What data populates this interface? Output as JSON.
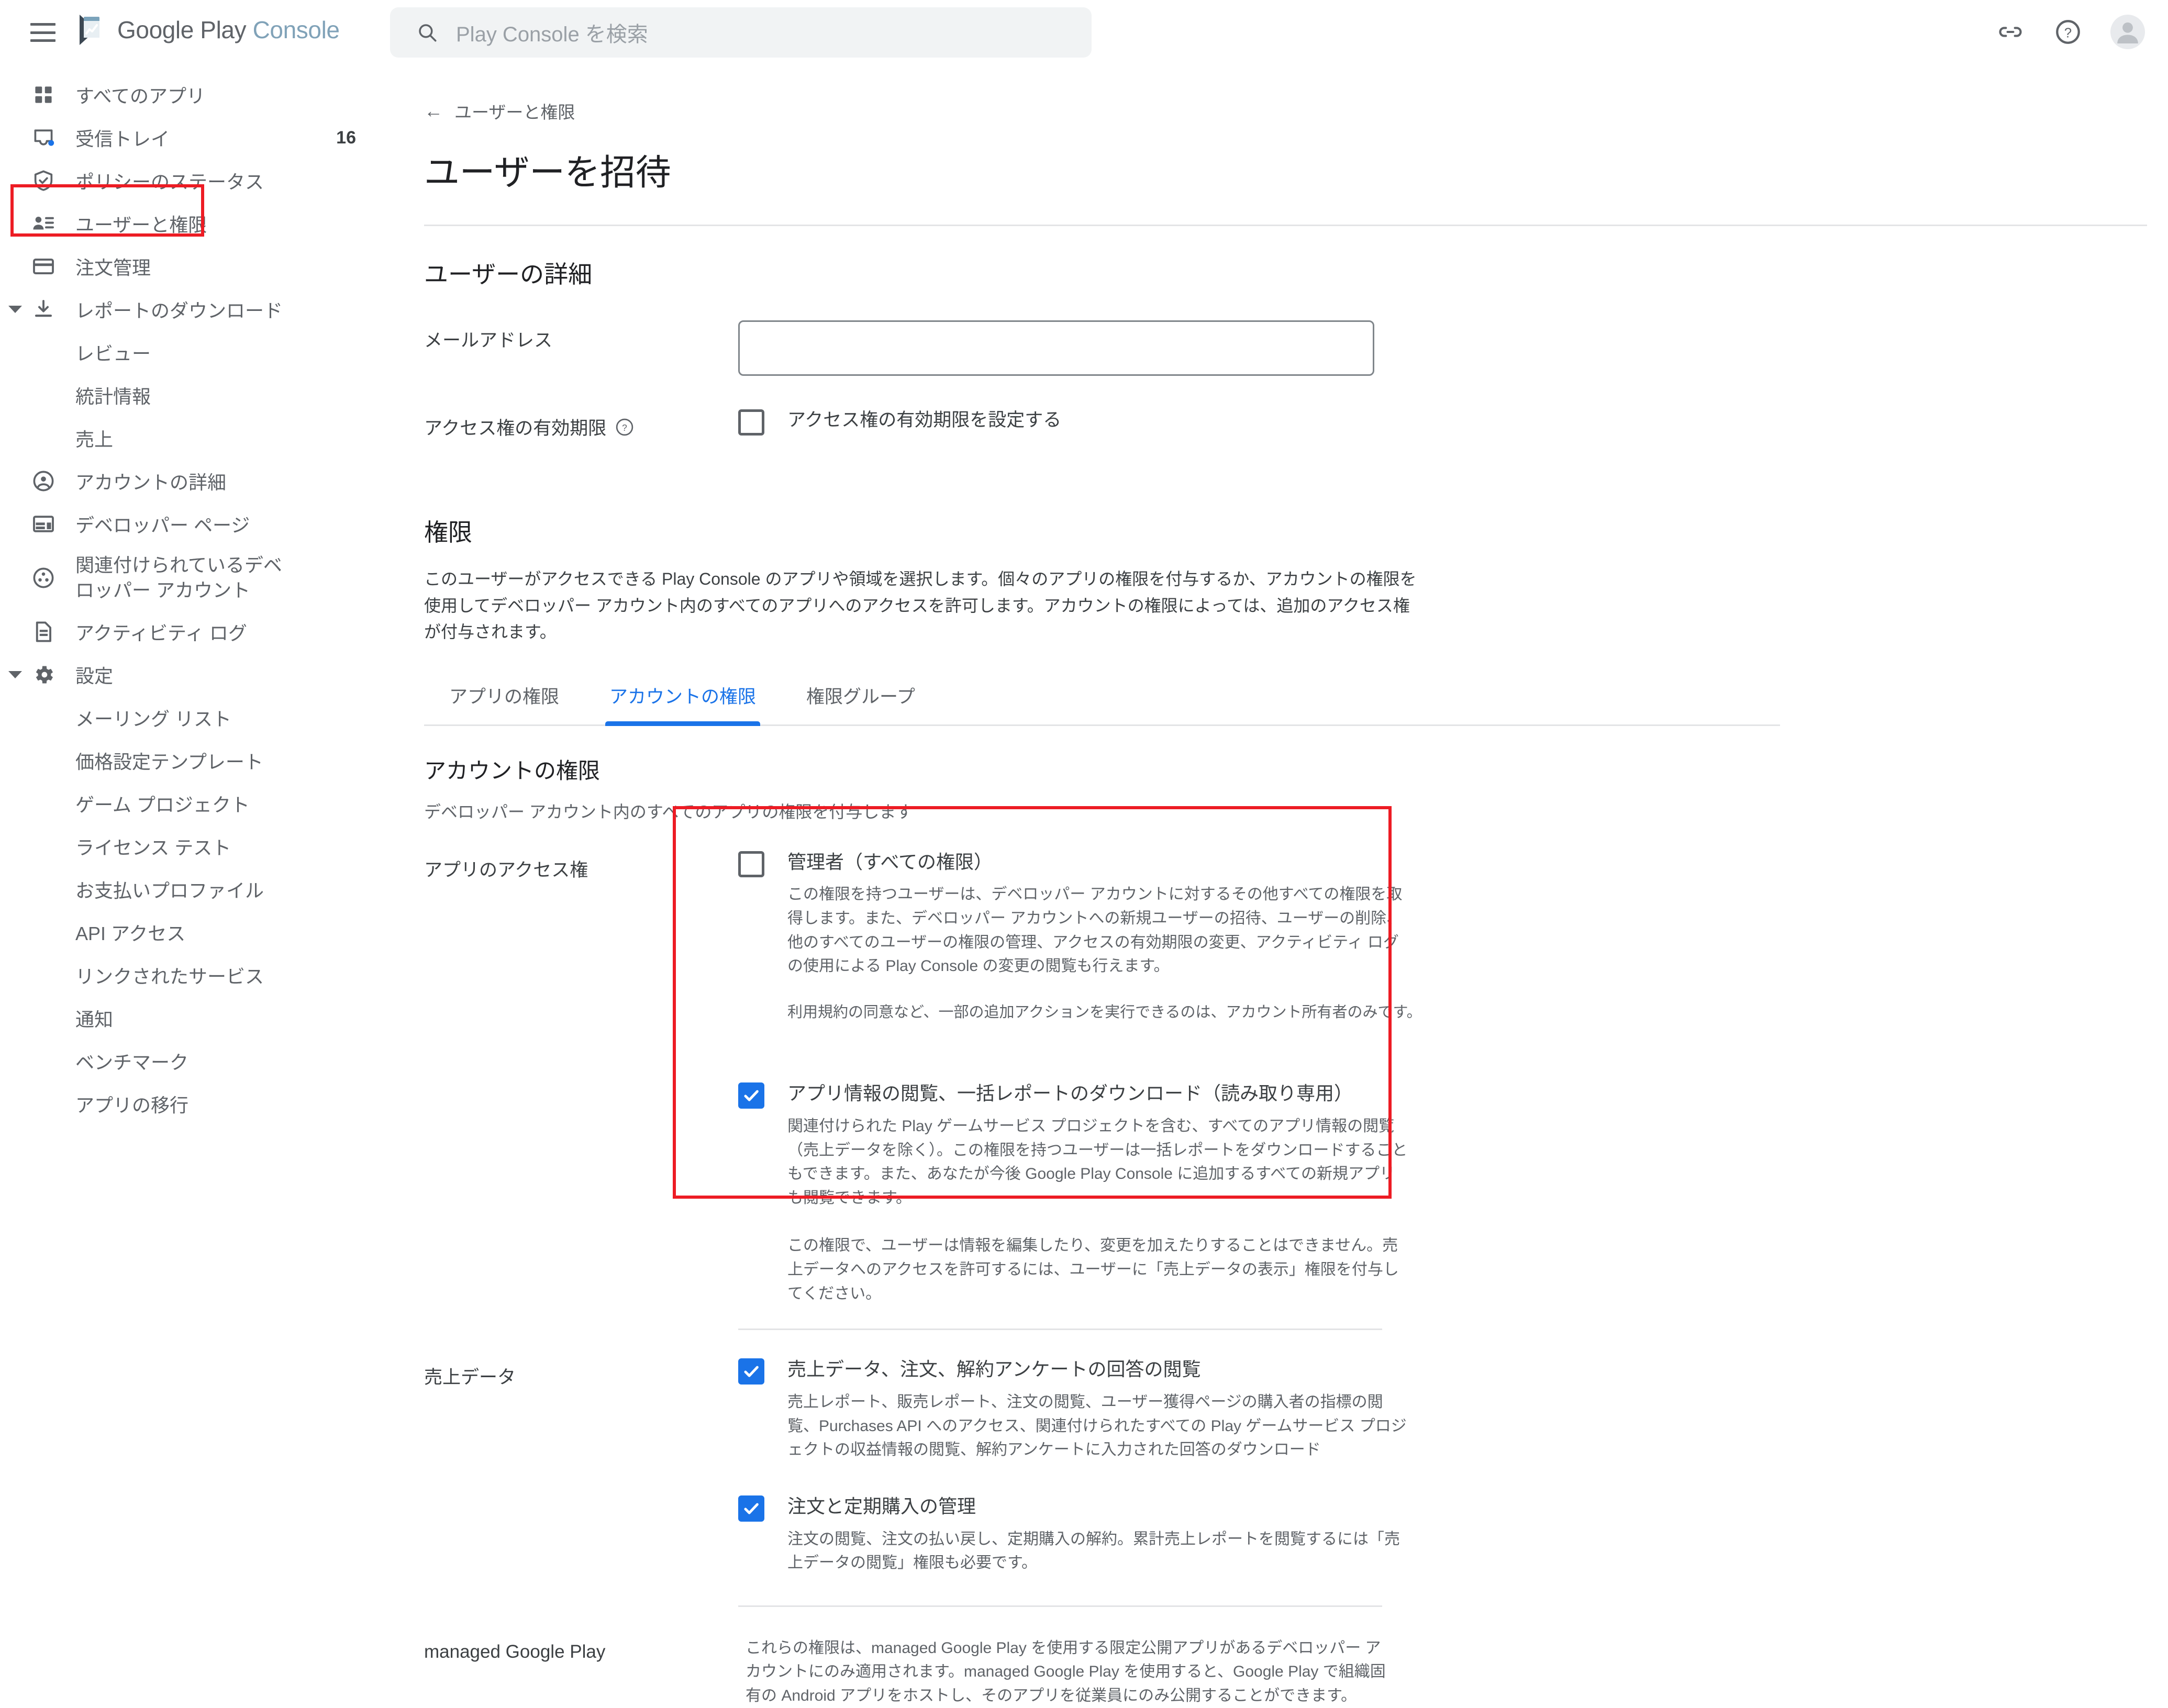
{
  "header": {
    "menu_icon": "hamburger-menu-icon",
    "brand_google": "Google Play",
    "brand_console": "Console",
    "search_placeholder": "Play Console を検索",
    "search_icon": "search-icon",
    "link_icon": "link-icon",
    "help_icon": "help-circle-icon",
    "avatar_icon": "account-avatar-icon"
  },
  "sidebar": {
    "items": [
      {
        "label": "すべてのアプリ",
        "icon": "apps-grid-icon",
        "badge": ""
      },
      {
        "label": "受信トレイ",
        "icon": "inbox-icon",
        "badge": "16"
      },
      {
        "label": "ポリシーのステータス",
        "icon": "shield-check-icon",
        "badge": ""
      },
      {
        "label": "ユーザーと権限",
        "icon": "users-permissions-icon",
        "badge": ""
      },
      {
        "label": "注文管理",
        "icon": "credit-card-icon",
        "badge": ""
      },
      {
        "label": "レポートのダウンロード",
        "icon": "download-icon",
        "badge": ""
      }
    ],
    "reports_children": [
      {
        "label": "レビュー"
      },
      {
        "label": "統計情報"
      },
      {
        "label": "売上"
      }
    ],
    "items2": [
      {
        "label": "アカウントの詳細",
        "icon": "account-circle-icon"
      },
      {
        "label": "デベロッパー ページ",
        "icon": "developer-page-icon"
      },
      {
        "label": "関連付けられているデベロッパー アカウント",
        "icon": "linked-accounts-icon"
      },
      {
        "label": "アクティビティ ログ",
        "icon": "activity-log-icon"
      },
      {
        "label": "設定",
        "icon": "gear-icon"
      }
    ],
    "settings_children": [
      {
        "label": "メーリング リスト"
      },
      {
        "label": "価格設定テンプレート"
      },
      {
        "label": "ゲーム プロジェクト"
      },
      {
        "label": "ライセンス テスト"
      },
      {
        "label": "お支払いプロファイル"
      },
      {
        "label": "API アクセス"
      },
      {
        "label": "リンクされたサービス"
      },
      {
        "label": "通知"
      },
      {
        "label": "ベンチマーク"
      },
      {
        "label": "アプリの移行"
      }
    ]
  },
  "main": {
    "breadcrumb": "ユーザーと権限",
    "breadcrumb_arrow": "←",
    "page_title": "ユーザーを招待",
    "user_details": {
      "heading": "ユーザーの詳細",
      "email_label": "メールアドレス",
      "email_value": "",
      "email_placeholder": "",
      "expiry_label": "アクセス権の有効期限",
      "expiry_help_icon": "help-circle-icon",
      "expiry_checkbox_label": "アクセス権の有効期限を設定する",
      "expiry_checked": false
    },
    "permissions": {
      "heading": "権限",
      "description": "このユーザーがアクセスできる Play Console のアプリや領域を選択します。個々のアプリの権限を付与するか、アカウントの権限を使用してデベロッパー アカウント内のすべてのアプリへのアクセスを許可します。アカウントの権限によっては、追加のアクセス権が付与されます。",
      "tabs": [
        {
          "label": "アプリの権限",
          "active": false
        },
        {
          "label": "アカウントの権限",
          "active": true
        },
        {
          "label": "権限グループ",
          "active": false
        }
      ],
      "account_heading": "アカウントの権限",
      "account_subnote": "デベロッパー アカウント内のすべてのアプリの権限を付与します",
      "groups": [
        {
          "label": "アプリのアクセス権",
          "options": [
            {
              "title": "管理者（すべての権限）",
              "checked": false,
              "desc": "この権限を持つユーザーは、デベロッパー アカウントに対するその他すべての権限を取得します。また、デベロッパー アカウントへの新規ユーザーの招待、ユーザーの削除、他のすべてのユーザーの権限の管理、アクセスの有効期限の変更、アクティビティ ログの使用による Play Console の変更の閲覧も行えます。",
              "note": "利用規約の同意など、一部の追加アクションを実行できるのは、アカウント所有者のみです。"
            },
            {
              "title": "アプリ情報の閲覧、一括レポートのダウンロード（読み取り専用）",
              "checked": true,
              "desc": "関連付けられた Play ゲームサービス プロジェクトを含む、すべてのアプリ情報の閲覧（売上データを除く）。この権限を持つユーザーは一括レポートをダウンロードすることもできます。また、あなたが今後 Google Play Console に追加するすべての新規アプリも閲覧できます。",
              "desc2": "この権限で、ユーザーは情報を編集したり、変更を加えたりすることはできません。売上データへのアクセスを許可するには、ユーザーに「売上データの表示」権限を付与してください。"
            }
          ]
        },
        {
          "label": "売上データ",
          "options": [
            {
              "title": "売上データ、注文、解約アンケートの回答の閲覧",
              "checked": true,
              "desc": "売上レポート、販売レポート、注文の閲覧、ユーザー獲得ページの購入者の指標の閲覧、Purchases API へのアクセス、関連付けられたすべての Play ゲームサービス プロジェクトの収益情報の閲覧、解約アンケートに入力された回答のダウンロード"
            },
            {
              "title": "注文と定期購入の管理",
              "checked": true,
              "desc": "注文の閲覧、注文の払い戻し、定期購入の解約。累計売上レポートを閲覧するには「売上データの閲覧」権限も必要です。"
            }
          ]
        },
        {
          "label": "managed Google Play",
          "plain_desc": "これらの権限は、managed Google Play を使用する限定公開アプリがあるデベロッパー アカウントにのみ適用されます。managed Google Play を使用すると、Google Play で組織固有の Android アプリをホストし、そのアプリを従業員にのみ公開することができます。"
        }
      ]
    }
  },
  "colors": {
    "accent": "#1a73e8",
    "highlight": "#ed1c24",
    "text_primary": "#202124",
    "text_secondary": "#5f6368"
  }
}
